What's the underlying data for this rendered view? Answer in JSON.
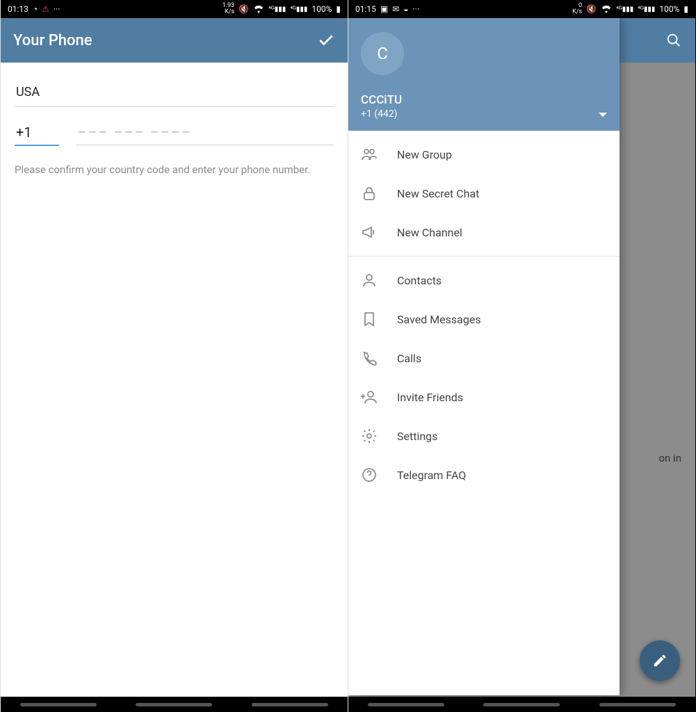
{
  "left": {
    "statusbar": {
      "time": "01:13",
      "speed": "1.93\nK/s",
      "battery": "100%"
    },
    "header": {
      "title": "Your Phone"
    },
    "country": "USA",
    "phone_code": "+1",
    "phone_placeholder": "––– ––– ––––",
    "hint": "Please confirm your country code and enter your phone number."
  },
  "right": {
    "statusbar": {
      "time": "01:15",
      "speed": "0\nK/s",
      "battery": "100%"
    },
    "backdrop_text": "on in",
    "drawer": {
      "avatar_letter": "C",
      "user_name": "CCCiTU",
      "user_phone": "+1 (442)",
      "items_a": [
        {
          "key": "new-group",
          "label": "New Group"
        },
        {
          "key": "new-secret-chat",
          "label": "New Secret Chat"
        },
        {
          "key": "new-channel",
          "label": "New Channel"
        }
      ],
      "items_b": [
        {
          "key": "contacts",
          "label": "Contacts"
        },
        {
          "key": "saved-messages",
          "label": "Saved Messages"
        },
        {
          "key": "calls",
          "label": "Calls"
        },
        {
          "key": "invite-friends",
          "label": "Invite Friends"
        },
        {
          "key": "settings",
          "label": "Settings"
        },
        {
          "key": "telegram-faq",
          "label": "Telegram FAQ"
        }
      ]
    }
  }
}
